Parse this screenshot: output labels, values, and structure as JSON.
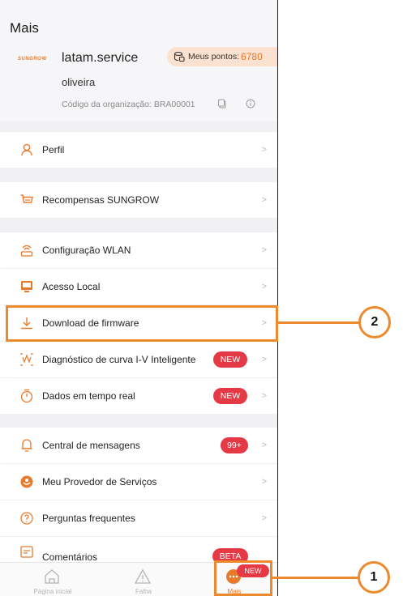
{
  "header": {
    "title": "Mais",
    "logo_text": "SUNGROW",
    "account": "latam.service",
    "user": "oliveira",
    "org_code": "Código da organização: BRA00001",
    "points_label": "Meus pontos:",
    "points_value": "6780"
  },
  "menu": {
    "perfil": "Perfil",
    "recompensas": "Recompensas SUNGROW",
    "wlan": "Configuração WLAN",
    "local": "Acesso Local",
    "firmware": "Download de firmware",
    "iv": "Diagnóstico de curva I-V Inteligente",
    "tempo_real": "Dados em tempo real",
    "mensagens": "Central de mensagens",
    "provedor": "Meu Provedor de Serviços",
    "faq": "Perguntas frequentes",
    "comentarios": "Comentários"
  },
  "badges": {
    "new": "NEW",
    "count": "99+",
    "beta": "BETA"
  },
  "chevron": ">",
  "tabbar": {
    "home": "Página inicial",
    "faults": "Falha",
    "more": "Mais",
    "more_badge": "NEW"
  },
  "callouts": {
    "one": "1",
    "two": "2"
  },
  "colors": {
    "accent": "#ee8a2e",
    "badge_red": "#e53a46",
    "icon_orange": "#e87a2a"
  }
}
